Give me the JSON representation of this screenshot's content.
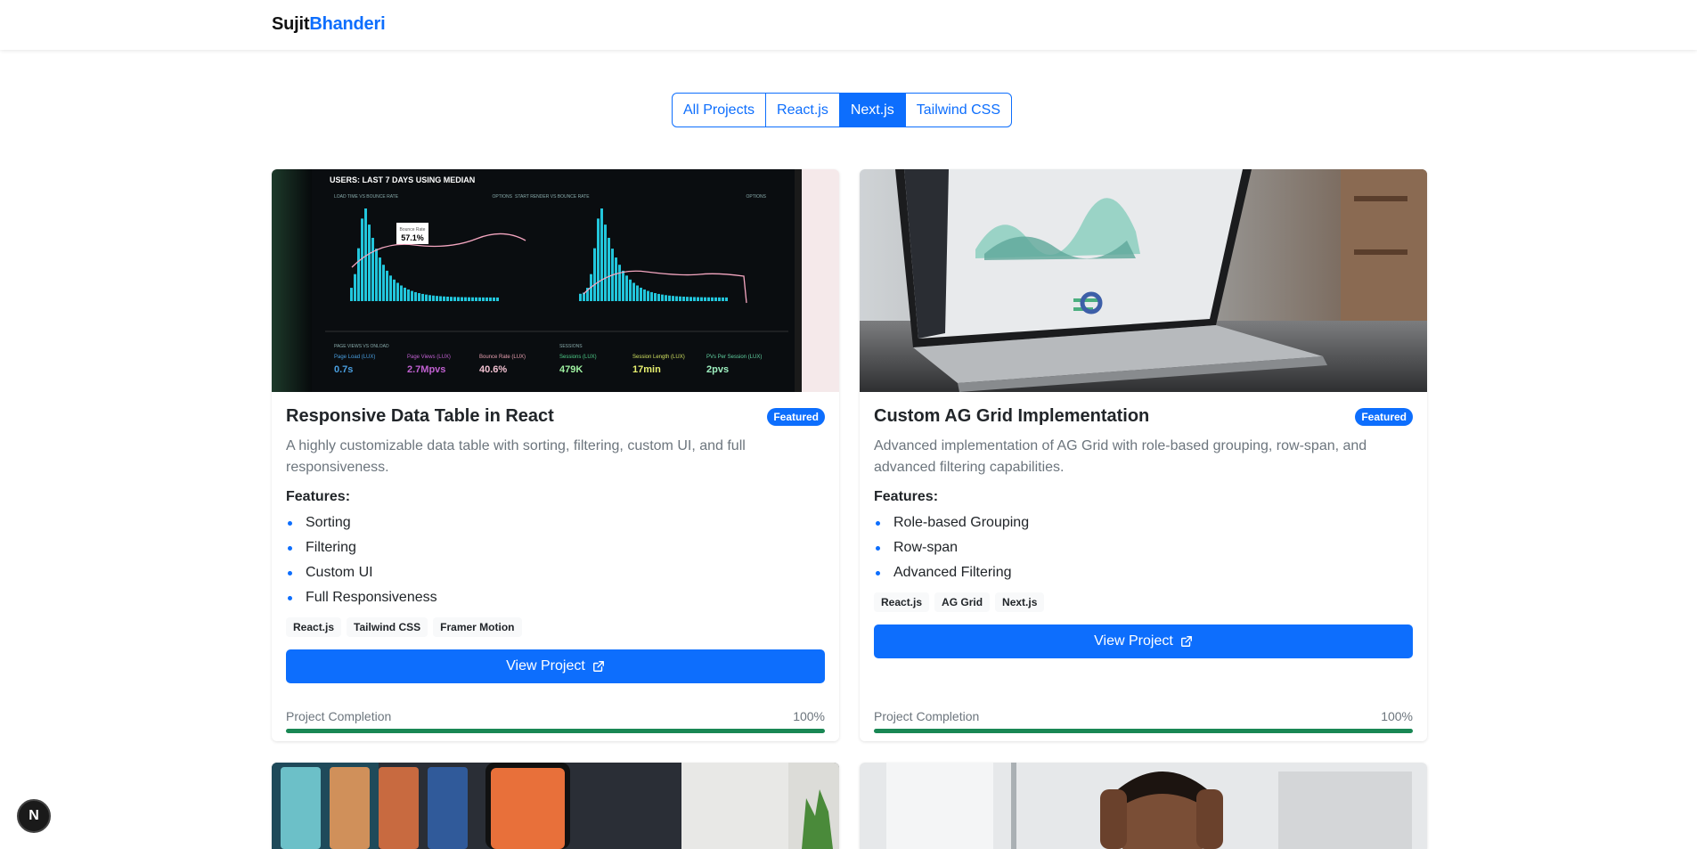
{
  "brand": {
    "part1": "Sujit",
    "part2": "Bhanderi"
  },
  "filters": [
    {
      "label": "All Projects",
      "active": false
    },
    {
      "label": "React.js",
      "active": false
    },
    {
      "label": "Next.js",
      "active": true
    },
    {
      "label": "Tailwind CSS",
      "active": false
    }
  ],
  "cards": [
    {
      "title": "Responsive Data Table in React",
      "badge": "Featured",
      "description": "A highly customizable data table with sorting, filtering, custom UI, and full responsiveness.",
      "features_heading": "Features:",
      "features": [
        "Sorting",
        "Filtering",
        "Custom UI",
        "Full Responsiveness"
      ],
      "tags": [
        "React.js",
        "Tailwind CSS",
        "Framer Motion"
      ],
      "button_label": "View Project",
      "progress_label": "Project Completion",
      "progress_value": "100%",
      "progress": 1.0
    },
    {
      "title": "Custom AG Grid Implementation",
      "badge": "Featured",
      "description": "Advanced implementation of AG Grid with role-based grouping, row-span, and advanced filtering capabilities.",
      "features_heading": "Features:",
      "features": [
        "Role-based Grouping",
        "Row-span",
        "Advanced Filtering"
      ],
      "tags": [
        "React.js",
        "AG Grid",
        "Next.js"
      ],
      "button_label": "View Project",
      "progress_label": "Project Completion",
      "progress_value": "100%",
      "progress": 1.0
    }
  ],
  "screenshot_text": {
    "dash_header": "USERS: LAST 7 DAYS USING MEDIAN",
    "chart1_title": "LOAD TIME VS BOUNCE RATE",
    "chart2_title": "START RENDER VS BOUNCE RATE",
    "options": "OPTIONS",
    "tooltip_label": "Bounce Rate",
    "tooltip_value": "57.1%",
    "section1": "PAGE VIEWS VS ONLOAD",
    "section2": "SESSIONS",
    "metrics": [
      {
        "label": "Page Load (LUX)",
        "value": "0.7s"
      },
      {
        "label": "Page Views (LUX)",
        "value": "2.7Mpvs"
      },
      {
        "label": "Bounce Rate (LUX)",
        "value": "40.6%"
      },
      {
        "label": "Sessions (LUX)",
        "value": "479K"
      },
      {
        "label": "Session Length (LUX)",
        "value": "17min"
      },
      {
        "label": "PVs Per Session (LUX)",
        "value": "2pvs"
      }
    ]
  },
  "floating_badge": "N",
  "colors": {
    "primary": "#0d6efd",
    "success": "#198754"
  }
}
